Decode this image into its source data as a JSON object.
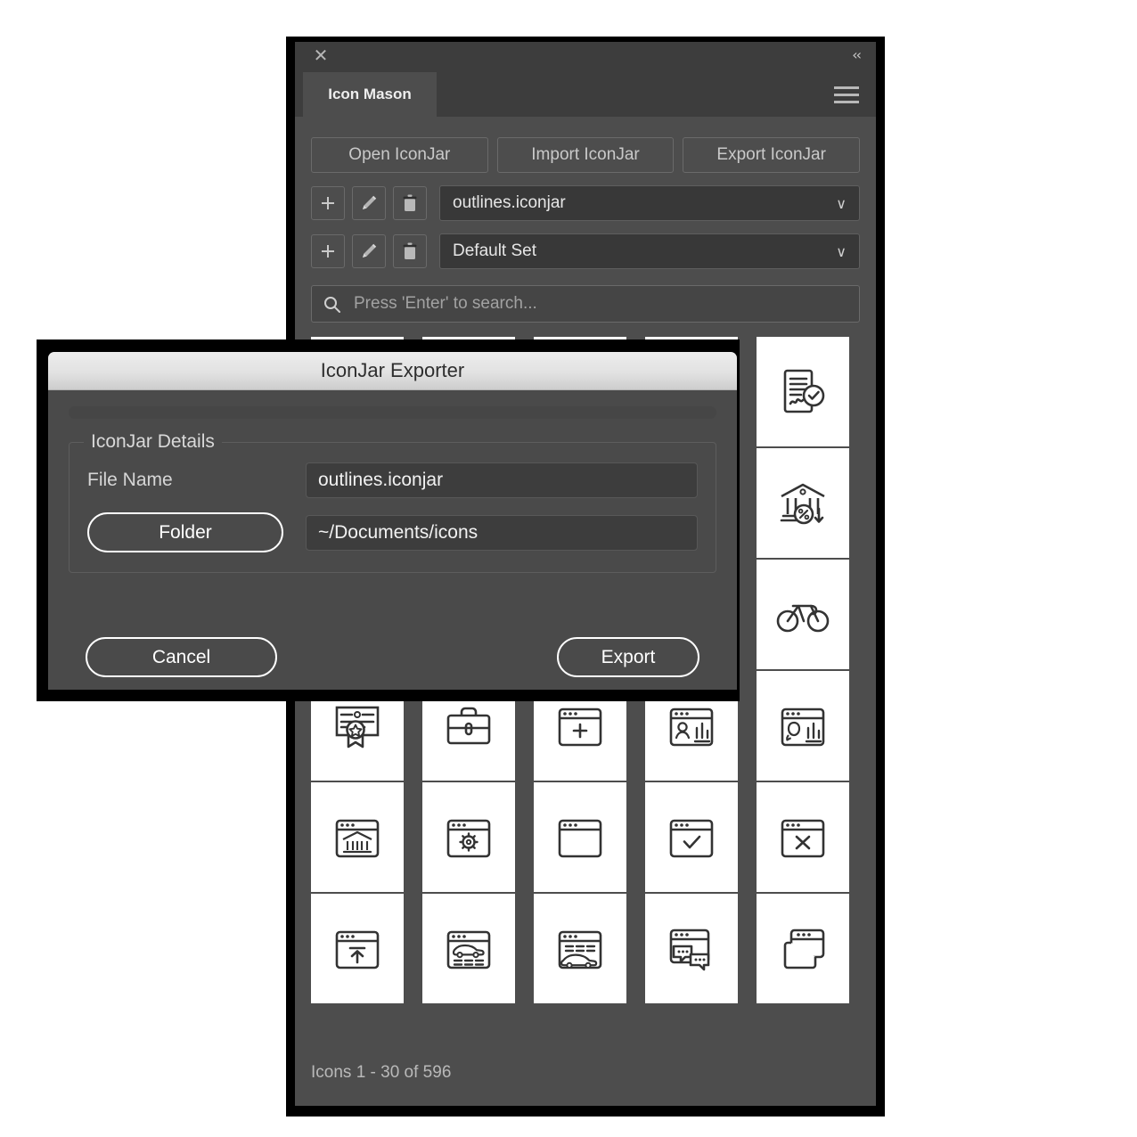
{
  "panel": {
    "close_icon": "close-icon",
    "collapse_icon": "double-chevron-left-icon",
    "tab_label": "Icon Mason",
    "menu_icon": "hamburger-menu-icon",
    "toolbar": {
      "open_label": "Open IconJar",
      "import_label": "Import IconJar",
      "export_label": "Export IconJar"
    },
    "jar_row": {
      "add_icon": "plus-icon",
      "edit_icon": "pencil-icon",
      "delete_icon": "trash-icon",
      "value": "outlines.iconjar",
      "chevron": "∨"
    },
    "set_row": {
      "add_icon": "plus-icon",
      "edit_icon": "pencil-icon",
      "delete_icon": "trash-icon",
      "value": "Default Set",
      "chevron": "∨"
    },
    "search": {
      "icon": "search-icon",
      "value": "",
      "placeholder": "Press 'Enter' to search..."
    },
    "status": "Icons 1 - 30 of 596",
    "grid": {
      "columns": 5,
      "rows": 6,
      "icons": [
        "icon-blank-1",
        "icon-blank-2",
        "icon-blank-3",
        "icon-blank-4",
        "signed-document-check-icon",
        "icon-blank-5",
        "icon-blank-6",
        "icon-blank-7",
        "icon-blank-8",
        "bank-discount-down-icon",
        "icon-blank-9",
        "icon-blank-10",
        "icon-blank-11",
        "icon-blank-12",
        "bicycle-icon",
        "certificate-award-icon",
        "briefcase-icon",
        "browser-add-icon",
        "browser-profile-chart-icon",
        "browser-profile-chart-alt-icon",
        "browser-bank-icon",
        "browser-settings-icon",
        "browser-window-icon",
        "browser-check-icon",
        "browser-close-icon",
        "browser-upload-icon",
        "browser-car-listing-icon",
        "browser-car-search-icon",
        "browser-chat-icon",
        "browser-tabs-icon"
      ]
    }
  },
  "dialog": {
    "title": "IconJar Exporter",
    "fieldset_legend": "IconJar Details",
    "file_name_label": "File Name",
    "file_name_value": "outlines.iconjar",
    "folder_button_label": "Folder",
    "folder_path_value": "~/Documents/icons",
    "cancel_label": "Cancel",
    "export_label": "Export"
  },
  "colors": {
    "panel_bg": "#4d4d4d",
    "panel_chrome": "#3d3d3d",
    "dialog_bg": "#4a4a4a",
    "dialog_titlebar_top": "#ececec",
    "dialog_titlebar_bottom": "#cdcdcd",
    "field_bg": "#3d3d3d",
    "accent_outline": "#ffffff",
    "icon_stroke": "#333333",
    "cell_bg": "#ffffff"
  }
}
